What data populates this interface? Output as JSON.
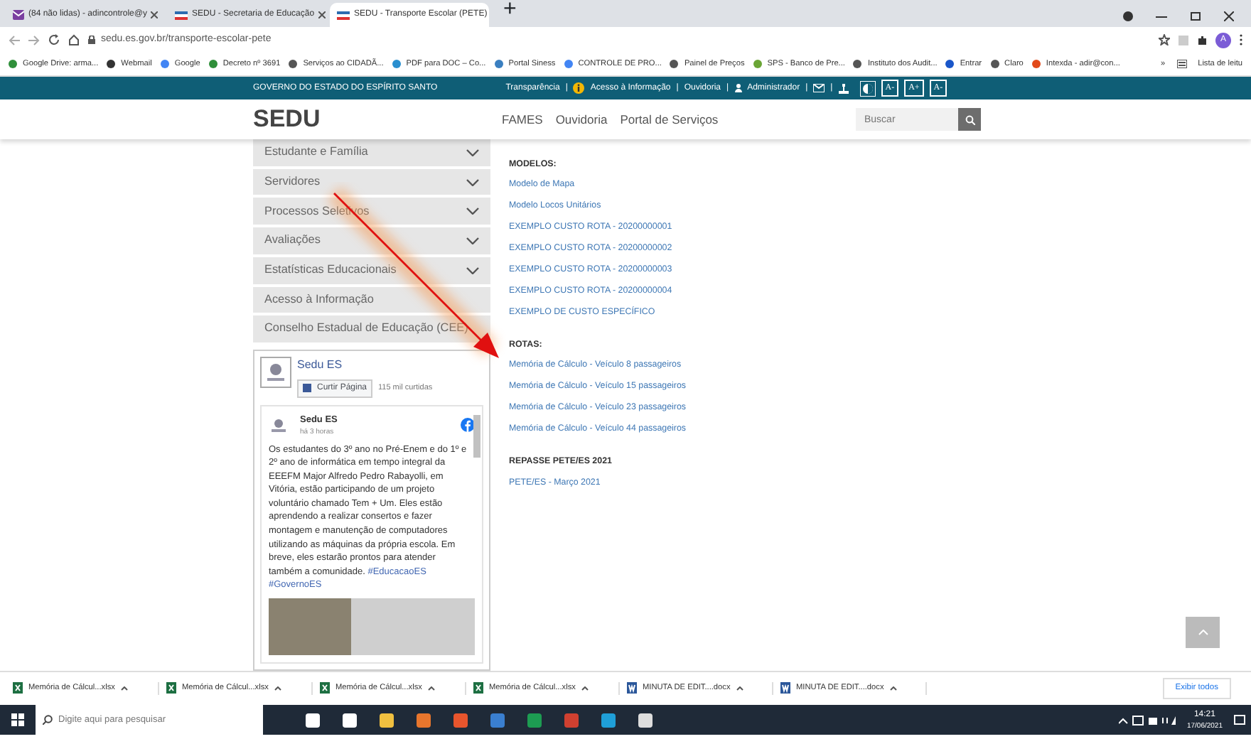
{
  "browser": {
    "tabs": [
      {
        "title": "(84 não lidas) - adincontrole@y",
        "kind": "mail",
        "selected": false
      },
      {
        "title": "SEDU - Secretaria de Educação",
        "kind": "flag",
        "selected": false
      },
      {
        "title": "SEDU - Transporte Escolar (PETE)",
        "kind": "flag",
        "selected": true
      }
    ],
    "new_tab": "+",
    "address": "sedu.es.gov.br/transporte-escolar-pete",
    "profile": "A",
    "bookmarks": [
      "Google Drive: arma...",
      "Webmail",
      "Google",
      "Decreto nº 3691",
      "Serviços ao CIDADÃ...",
      "PDF para DOC – Co...",
      "Portal Siness",
      "CONTROLE DE PRO...",
      "Painel de Preços",
      "SPS - Banco de Pre...",
      "Instituto dos Audit...",
      "Entrar",
      "Claro",
      "Intexda - adir@con..."
    ],
    "bookmarks_more": "»",
    "reading_list": "Lista de leitu"
  },
  "gov_bar": {
    "title": "GOVERNO DO ESTADO DO ESPÍRITO SANTO",
    "links": [
      "Transparência",
      "Acesso à Informação",
      "Ouvidoria",
      "Administrador"
    ],
    "separator": "|",
    "font_buttons": [
      "A-",
      "A+",
      "A-"
    ]
  },
  "header": {
    "logo": "SEDU",
    "nav": [
      "FAMES",
      "Ouvidoria",
      "Portal de Serviços"
    ],
    "search": {
      "placeholder": "Buscar"
    }
  },
  "sidebar": {
    "items": [
      {
        "label": "Estudante e Família",
        "expandable": true
      },
      {
        "label": "Servidores",
        "expandable": true
      },
      {
        "label": "Processos Seletivos",
        "expandable": true
      },
      {
        "label": "Avaliações",
        "expandable": true
      },
      {
        "label": "Estatísticas Educacionais",
        "expandable": true
      },
      {
        "label": "Acesso à Informação",
        "expandable": false
      },
      {
        "label": "Conselho Estadual de Educação (CEE)",
        "expandable": false
      }
    ]
  },
  "facebook": {
    "page": "Sedu ES",
    "like_button": "Curtir Página",
    "likes": "115 mil curtidas",
    "post": {
      "author": "Sedu ES",
      "time": "há 3 horas",
      "text": "Os estudantes do 3º ano no Pré-Enem e do 1º e 2º ano de informática em tempo integral da EEEFM Major Alfredo Pedro Rabayolli, em Vitória, estão participando de um projeto voluntário chamado Tem + Um. Eles estão aprendendo a realizar consertos e fazer montagem e manutenção de computadores utilizando as máquinas da própria escola. Em breve, eles estarão prontos para atender também a comunidade.",
      "hashtags": [
        "#EducacaoES",
        "#GovernoES"
      ]
    }
  },
  "sections": [
    {
      "heading": "MODELOS:",
      "links": [
        "Modelo de Mapa",
        "Modelo Locos Unitários",
        "EXEMPLO CUSTO ROTA - 20200000001",
        "EXEMPLO CUSTO ROTA - 20200000002",
        "EXEMPLO CUSTO ROTA - 20200000003",
        "EXEMPLO CUSTO ROTA - 20200000004",
        "EXEMPLO DE CUSTO ESPECÍFICO"
      ]
    },
    {
      "heading": "ROTAS:",
      "links": [
        "Memória de Cálculo - Veículo 8 passageiros",
        "Memória de Cálculo - Veículo 15 passageiros",
        "Memória de Cálculo - Veículo 23 passageiros",
        "Memória de Cálculo - Veículo 44 passageiros"
      ]
    },
    {
      "heading": "REPASSE PETE/ES 2021",
      "links": [
        "PETE/ES - Março 2021"
      ]
    }
  ],
  "downloads": {
    "items": [
      {
        "name": "Memória de Cálcul...xlsx",
        "kind": "excel"
      },
      {
        "name": "Memória de Cálcul...xlsx",
        "kind": "excel"
      },
      {
        "name": "Memória de Cálcul...xlsx",
        "kind": "excel"
      },
      {
        "name": "Memória de Cálcul...xlsx",
        "kind": "excel"
      },
      {
        "name": "MINUTA DE EDIT....docx",
        "kind": "word"
      },
      {
        "name": "MINUTA DE EDIT....docx",
        "kind": "word"
      }
    ],
    "show_all": "Exibir todos"
  },
  "taskbar": {
    "search": {
      "placeholder": "Digite aqui para pesquisar"
    },
    "time": "14:21",
    "date": "17/06/2021"
  }
}
